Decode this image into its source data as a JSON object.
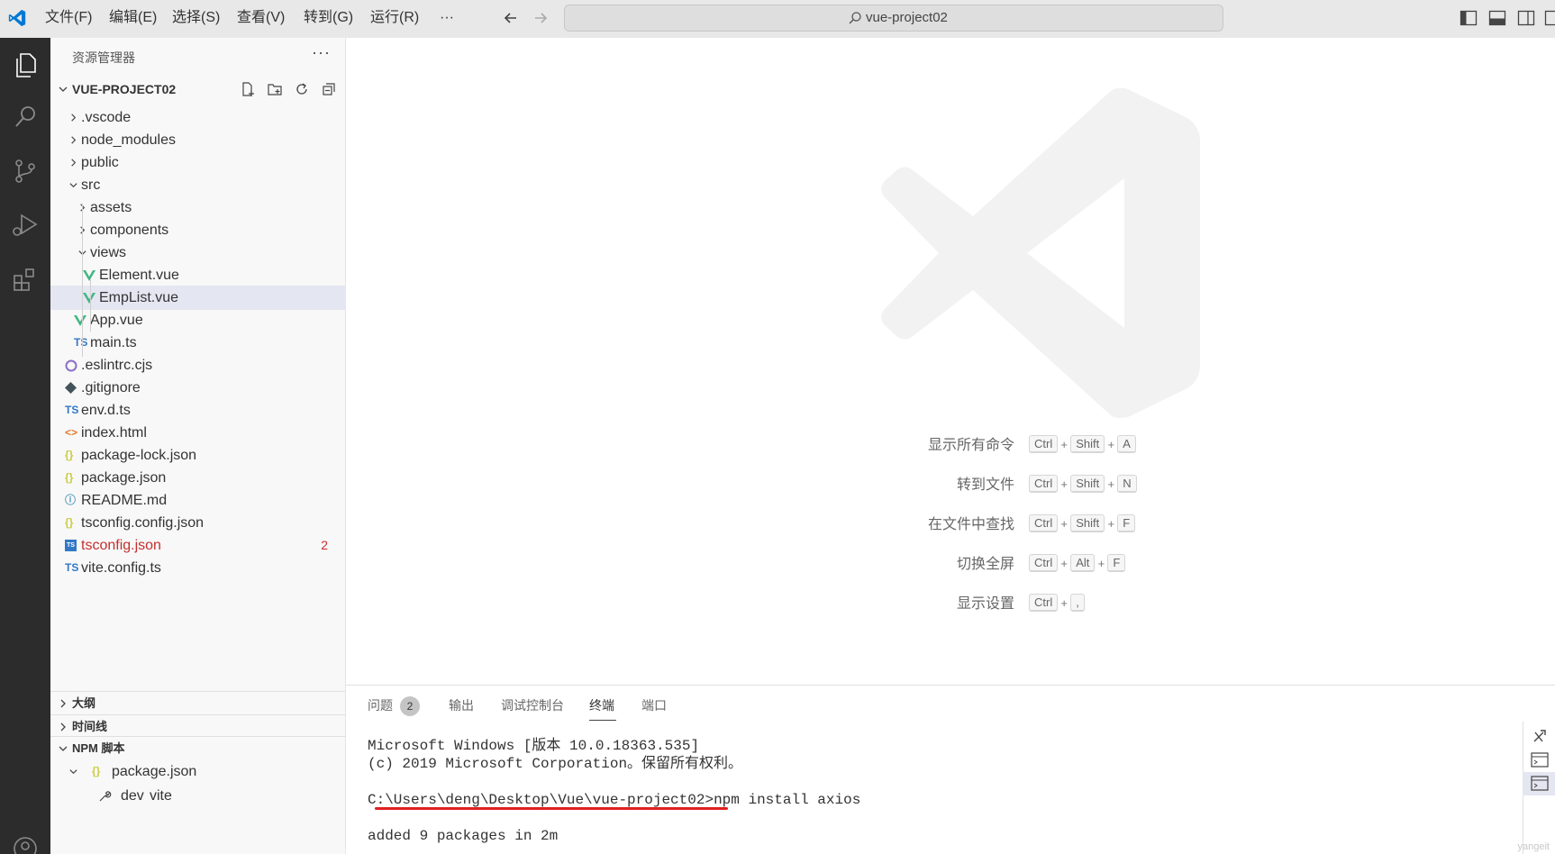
{
  "menu": [
    "文件(F)",
    "编辑(E)",
    "选择(S)",
    "查看(V)",
    "转到(G)",
    "运行(R)",
    "···"
  ],
  "search": {
    "text": "vue-project02"
  },
  "activity": [
    "explorer-icon",
    "search-icon",
    "source-control-icon",
    "run-debug-icon",
    "extensions-icon",
    "account-icon"
  ],
  "sidebar": {
    "title": "资源管理器",
    "more": "···",
    "project": "VUE-PROJECT02",
    "tree": [
      {
        "label": ".vscode",
        "indent": 0,
        "kind": "folder",
        "expanded": false
      },
      {
        "label": "node_modules",
        "indent": 0,
        "kind": "folder",
        "expanded": false
      },
      {
        "label": "public",
        "indent": 0,
        "kind": "folder",
        "expanded": false
      },
      {
        "label": "src",
        "indent": 0,
        "kind": "folder",
        "expanded": true
      },
      {
        "label": "assets",
        "indent": 1,
        "kind": "folder",
        "expanded": false
      },
      {
        "label": "components",
        "indent": 1,
        "kind": "folder",
        "expanded": false
      },
      {
        "label": "views",
        "indent": 1,
        "kind": "folder",
        "expanded": true
      },
      {
        "label": "Element.vue",
        "indent": 2,
        "kind": "vue"
      },
      {
        "label": "EmpList.vue",
        "indent": 2,
        "kind": "vue",
        "selected": true
      },
      {
        "label": "App.vue",
        "indent": 1,
        "kind": "vue"
      },
      {
        "label": "main.ts",
        "indent": 1,
        "kind": "ts",
        "icon_text": "TS"
      },
      {
        "label": ".eslintrc.cjs",
        "indent": 0,
        "kind": "eslint"
      },
      {
        "label": ".gitignore",
        "indent": 0,
        "kind": "git"
      },
      {
        "label": "env.d.ts",
        "indent": 0,
        "kind": "ts",
        "icon_text": "TS"
      },
      {
        "label": "index.html",
        "indent": 0,
        "kind": "html",
        "icon_text": "<>"
      },
      {
        "label": "package-lock.json",
        "indent": 0,
        "kind": "json",
        "icon_text": "{}"
      },
      {
        "label": "package.json",
        "indent": 0,
        "kind": "json",
        "icon_text": "{}"
      },
      {
        "label": "README.md",
        "indent": 0,
        "kind": "info",
        "icon_text": "ⓘ"
      },
      {
        "label": "tsconfig.config.json",
        "indent": 0,
        "kind": "json",
        "icon_text": "{}"
      },
      {
        "label": "tsconfig.json",
        "indent": 0,
        "kind": "tsconfig",
        "icon_text": "TS",
        "error": true,
        "badge": "2"
      },
      {
        "label": "vite.config.ts",
        "indent": 0,
        "kind": "ts",
        "icon_text": "TS"
      }
    ],
    "sections": [
      {
        "label": "大纲",
        "expanded": false
      },
      {
        "label": "时间线",
        "expanded": false
      },
      {
        "label": "NPM 脚本",
        "expanded": true
      }
    ],
    "npm": {
      "file": "package.json",
      "file_icon": "{}",
      "script": "dev",
      "command": "vite"
    }
  },
  "editor": {
    "shortcuts": [
      {
        "label": "显示所有命令",
        "keys": [
          "Ctrl",
          "Shift",
          "A"
        ]
      },
      {
        "label": "转到文件",
        "keys": [
          "Ctrl",
          "Shift",
          "N"
        ]
      },
      {
        "label": "在文件中查找",
        "keys": [
          "Ctrl",
          "Shift",
          "F"
        ]
      },
      {
        "label": "切换全屏",
        "keys": [
          "Ctrl",
          "Alt",
          "F"
        ]
      },
      {
        "label": "显示设置",
        "keys": [
          "Ctrl",
          ","
        ]
      }
    ]
  },
  "panel": {
    "tabs": [
      {
        "label": "问题",
        "count": "2"
      },
      {
        "label": "输出"
      },
      {
        "label": "调试控制台"
      },
      {
        "label": "终端",
        "active": true
      },
      {
        "label": "端口"
      }
    ],
    "terminal": [
      "Microsoft Windows [版本 10.0.18363.535]",
      "(c) 2019 Microsoft Corporation。保留所有权利。",
      "",
      "C:\\Users\\deng\\Desktop\\Vue\\vue-project02>npm install axios",
      "",
      "added 9 packages in 2m"
    ],
    "watermark": "yangeit"
  },
  "colors": {
    "accent": "#0078d4",
    "vue_green": "#41b883",
    "ts_blue": "#3178c6",
    "json_yellow": "#cbcb41",
    "error_red": "#c72e2e",
    "annotation_red": "#e02020"
  }
}
